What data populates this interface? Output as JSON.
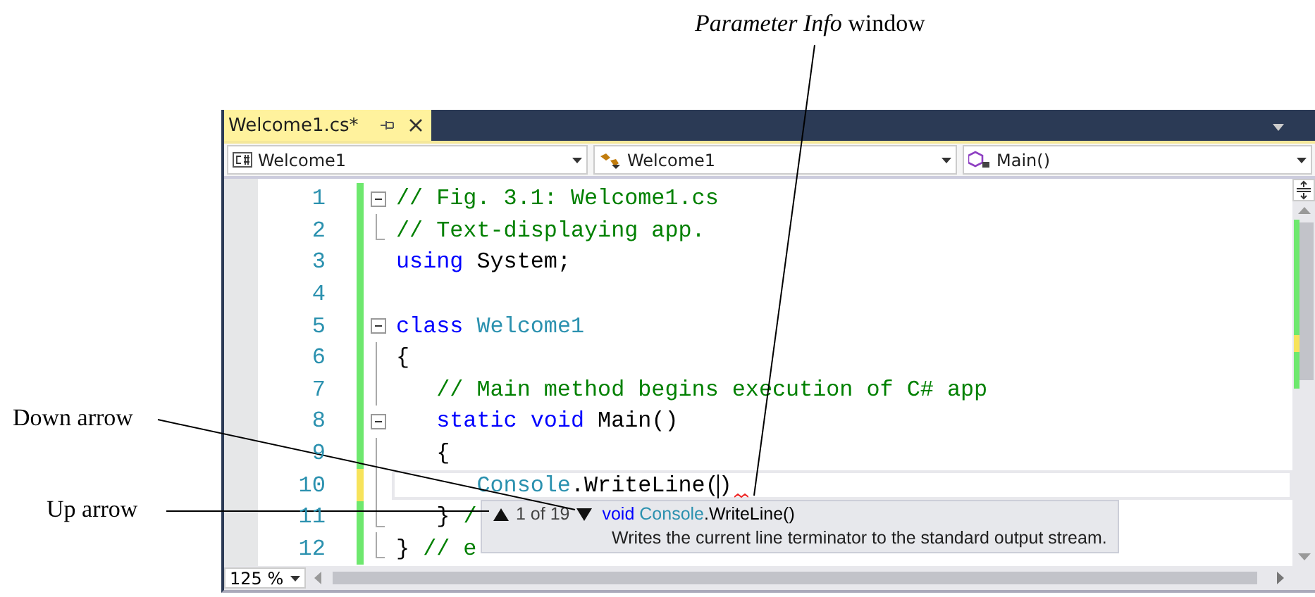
{
  "callouts": [
    {
      "kind": "top",
      "text": "*Parameter Info* window"
    },
    {
      "kind": "down",
      "text": "Down arrow"
    },
    {
      "kind": "up",
      "text": "Up arrow"
    }
  ],
  "editor": {
    "tab": {
      "title": "Welcome1.cs*",
      "selected": true
    },
    "nav": [
      {
        "kind": "class",
        "label": "Welcome1"
      },
      {
        "kind": "type",
        "label": "Welcome1"
      },
      {
        "kind": "method",
        "label": "Main()"
      }
    ],
    "lines": [
      {
        "number": "1",
        "modified": false,
        "kind": "fold",
        "current": false,
        "error": false,
        "tokens": [
          {
            "kind": "comment",
            "text": "// Fig. 3.1: Welcome1.cs"
          }
        ]
      },
      {
        "number": "2",
        "modified": false,
        "kind": "end",
        "current": false,
        "error": false,
        "tokens": [
          {
            "kind": "comment",
            "text": "// Text-displaying app."
          }
        ]
      },
      {
        "number": "3",
        "modified": false,
        "kind": "plain",
        "current": false,
        "error": false,
        "tokens": [
          {
            "kind": "keyword",
            "text": "using"
          },
          {
            "kind": "plain",
            "text": " System;"
          }
        ]
      },
      {
        "number": "4",
        "modified": false,
        "kind": "plain",
        "current": false,
        "error": false
      },
      {
        "number": "5",
        "modified": false,
        "kind": "fold",
        "current": false,
        "error": false,
        "tokens": [
          {
            "kind": "keyword",
            "text": "class"
          },
          {
            "kind": "type",
            "text": " Welcome1"
          }
        ]
      },
      {
        "number": "6",
        "modified": false,
        "kind": "guide",
        "current": false,
        "error": false,
        "tokens": [
          {
            "kind": "plain",
            "text": "{"
          }
        ]
      },
      {
        "number": "7",
        "modified": false,
        "kind": "guide",
        "current": false,
        "error": false,
        "tokens": [
          {
            "kind": "comment",
            "text": "   // Main method begins execution of C# app"
          }
        ]
      },
      {
        "number": "8",
        "modified": false,
        "kind": "fold",
        "current": false,
        "error": false,
        "tokens": [
          {
            "kind": "keyword",
            "text": "   static void"
          },
          {
            "kind": "plain",
            "text": " Main()"
          }
        ]
      },
      {
        "number": "9",
        "modified": false,
        "kind": "guide",
        "current": false,
        "error": false,
        "tokens": [
          {
            "kind": "plain",
            "text": "   {"
          }
        ]
      },
      {
        "number": "10",
        "modified": true,
        "kind": "guide",
        "current": true,
        "error": true,
        "tokens": [
          {
            "kind": "type",
            "text": "      Console"
          },
          {
            "kind": "plain",
            "text": ".WriteLine()"
          }
        ]
      },
      {
        "number": "11",
        "modified": false,
        "kind": "end",
        "current": false,
        "error": false,
        "tokens": [
          {
            "kind": "plain",
            "text": "   } "
          },
          {
            "kind": "comment",
            "text": "/"
          }
        ]
      },
      {
        "number": "12",
        "modified": false,
        "kind": "end",
        "current": false,
        "error": false,
        "tokens": [
          {
            "kind": "plain",
            "text": "} "
          },
          {
            "kind": "comment",
            "text": "// e"
          }
        ]
      }
    ],
    "param_info": {
      "counter": "1 of 19",
      "signature": [
        {
          "kind": "keyword",
          "text": "void"
        },
        {
          "kind": "type",
          "text": " Console"
        },
        {
          "kind": "plain",
          "text": ".WriteLine()"
        }
      ],
      "description": "Writes the current line terminator to the standard output stream."
    },
    "zoom": "125 %"
  }
}
